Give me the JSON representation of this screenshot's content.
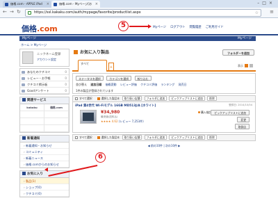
{
  "browser": {
    "tabs": [
      {
        "label": "価格.com - APPLE iPad"
      },
      {
        "label": "価格.com - Myページ[お"
      }
    ],
    "url": "https://ssl.kakaku.com/auth/mypage/favorite/productlist.aspx"
  },
  "site": {
    "logo_main": "価格",
    "logo_suffix": ".com",
    "topnav": [
      "Myページ",
      "ログアウト",
      "閲覧履歴",
      "ご利用ガイド"
    ]
  },
  "subbar": {
    "title": "Myページ",
    "right": "Myページ"
  },
  "breadcrumb": "ホーム > Myページ",
  "sidebar": {
    "profile_name": "ニックネーム登録",
    "profile_setting": "アカウント設定",
    "menu": [
      {
        "label": "あなたのクチコミ",
        "count": "0"
      },
      {
        "label": "レビュー・お手軽",
        "count": "0"
      },
      {
        "label": "クチコミ掲示板",
        "count": "0"
      },
      {
        "label": "Goodアンケート",
        "count": "0"
      }
    ],
    "services_title": "関連サービス",
    "services": [
      "kakaku",
      "価格.com",
      "",
      "",
      "",
      "",
      "",
      ""
    ],
    "news_title": "新着通知",
    "news_links": [
      "新着通知・お知らせ",
      "コミュニティ",
      "新着ニュース",
      "価格.comからのお知らせ"
    ],
    "fav_title": "お気に入り",
    "fav_links": [
      "製品(1)",
      "ショップ(0)",
      "クチコミ(0)"
    ]
  },
  "main": {
    "title": "お気に入り製品",
    "add_folder": "フォルダーを追加",
    "folder_tab": "すべて",
    "view_label": "表示",
    "filter": {
      "status_select": "ステータスを選択",
      "category_select": "カテゴリを選択",
      "refresh": "絞り込む",
      "sort_label": "並び替え",
      "sorts": [
        "追加日順",
        "価格変動",
        "レビュー評価",
        "クチコミ評価",
        "ランキング",
        "発売日"
      ],
      "count_text": "1件の製品が登録されています"
    },
    "listbar": {
      "select_all": "すべて選択",
      "checked": "選択した製品を",
      "buttons": [
        "取り扱い店舗",
        "フォルダに追加",
        "ピックアップリストに追加",
        "削除"
      ]
    },
    "product": {
      "name": "iPad 第4世代 Wi-Fiモデル 16GB MD513J/A [ホワイト]",
      "date": "登録日: 2014/10/04",
      "price": "¥34,980",
      "price_note": "最安値(送料込)",
      "rating": "★★★★ 4.62",
      "reviews": "(レビュー 7,253件)",
      "status": "購入検討中",
      "memo": "メモ",
      "btn1": "ピックアップリストに追加",
      "btn2": "変更",
      "btn3": "削除",
      "btn4": "取扱店"
    },
    "pager": "◀ 前の10件 | 次の10件 ▶"
  },
  "annotations": {
    "a5": "5",
    "a6": "6"
  },
  "colors": {
    "brand": "#1d3f86",
    "accent": "#e57a12",
    "annotation": "#e0181b"
  }
}
